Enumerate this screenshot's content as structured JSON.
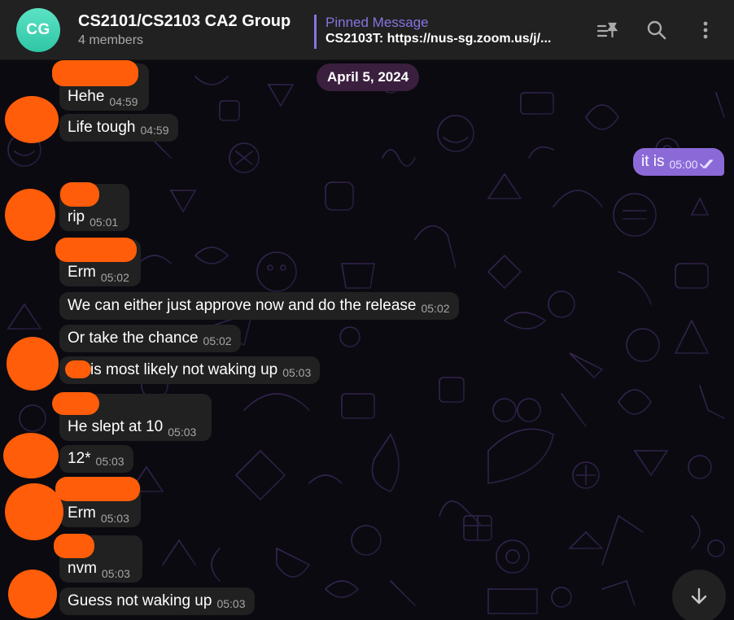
{
  "header": {
    "avatar_initials": "CG",
    "title": "CS2101/CS2103 CA2 Group",
    "subtitle": "4 members",
    "pinned_label": "Pinned Message",
    "pinned_text": "CS2103T: https://nus-sg.zoom.us/j/...",
    "icons": [
      "pinned-list-icon",
      "search-icon",
      "more-vert-icon"
    ]
  },
  "chat": {
    "date": "April 5, 2024",
    "messages": [
      {
        "text": "Hehe",
        "time": "04:59"
      },
      {
        "text": "Life tough",
        "time": "04:59"
      },
      {
        "text": "it is",
        "time": "05:00",
        "own": true,
        "read": true
      },
      {
        "text": "rip",
        "time": "05:01"
      },
      {
        "text": "Erm",
        "time": "05:02"
      },
      {
        "text": "We can either just approve now and do the release",
        "time": "05:02"
      },
      {
        "text": "Or take the chance",
        "time": "05:02"
      },
      {
        "text": "is most likely not waking up",
        "time": "05:03"
      },
      {
        "text": "He slept at 10",
        "time": "05:03"
      },
      {
        "text": "12*",
        "time": "05:03"
      },
      {
        "text": "Erm",
        "time": "05:03"
      },
      {
        "text": "nvm",
        "time": "05:03"
      },
      {
        "text": "Guess not waking up",
        "time": "05:03"
      }
    ]
  },
  "colors": {
    "accent": "#8774e1",
    "own_bubble": "#8b6ad8",
    "bubble": "#212121",
    "redaction": "#ff5d09",
    "date_pill": "#3b1f3e"
  }
}
